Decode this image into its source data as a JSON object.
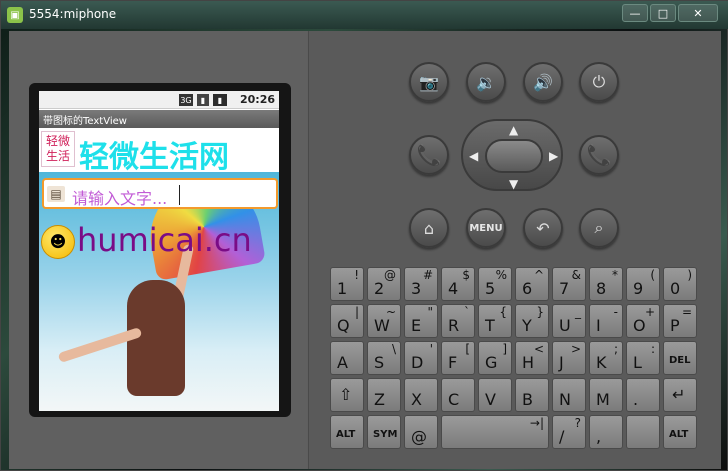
{
  "window": {
    "title": "5554:miphone",
    "controls": {
      "minimize": "—",
      "maximize": "□",
      "close": "✕"
    }
  },
  "device": {
    "status_bar": {
      "time": "20:26",
      "network": "3G"
    },
    "app_title": "带图标的TextView",
    "banner_text": "轻微生活网",
    "logo_text": "轻微生活",
    "input": {
      "placeholder": "请输入文字..."
    },
    "site_text": "humicai.cn"
  },
  "controls": {
    "top_row": [
      {
        "name": "camera-button",
        "icon": "📷"
      },
      {
        "name": "volume-down-button",
        "icon": "🔉"
      },
      {
        "name": "volume-up-button",
        "icon": "🔊"
      },
      {
        "name": "power-button",
        "icon": "⏻"
      }
    ],
    "call": {
      "call_icon": "📞",
      "end_icon": "📞"
    },
    "bottom_row": {
      "home": "⌂",
      "menu": "MENU",
      "back": "↶",
      "search": "⌕"
    }
  },
  "keyboard": {
    "rows": [
      [
        {
          "l": "1",
          "a": "!"
        },
        {
          "l": "2",
          "a": "@"
        },
        {
          "l": "3",
          "a": "#"
        },
        {
          "l": "4",
          "a": "$"
        },
        {
          "l": "5",
          "a": "%"
        },
        {
          "l": "6",
          "a": "^"
        },
        {
          "l": "7",
          "a": "&"
        },
        {
          "l": "8",
          "a": "*"
        },
        {
          "l": "9",
          "a": "("
        },
        {
          "l": "0",
          "a": ")"
        }
      ],
      [
        {
          "l": "Q",
          "a": "|"
        },
        {
          "l": "W",
          "a": "~"
        },
        {
          "l": "E",
          "a": "\""
        },
        {
          "l": "R",
          "a": "`"
        },
        {
          "l": "T",
          "a": "{"
        },
        {
          "l": "Y",
          "a": "}"
        },
        {
          "l": "U",
          "a": "_"
        },
        {
          "l": "I",
          "a": "-"
        },
        {
          "l": "O",
          "a": "+"
        },
        {
          "l": "P",
          "a": "="
        }
      ],
      [
        {
          "l": "A",
          "a": ""
        },
        {
          "l": "S",
          "a": "\\"
        },
        {
          "l": "D",
          "a": "'"
        },
        {
          "l": "F",
          "a": "["
        },
        {
          "l": "G",
          "a": "]"
        },
        {
          "l": "H",
          "a": "<"
        },
        {
          "l": "J",
          "a": ">"
        },
        {
          "l": "K",
          "a": ";"
        },
        {
          "l": "L",
          "a": ":"
        },
        {
          "l": "DEL",
          "a": ""
        }
      ],
      [
        {
          "l": "⇧",
          "a": ""
        },
        {
          "l": "Z",
          "a": ""
        },
        {
          "l": "X",
          "a": ""
        },
        {
          "l": "C",
          "a": ""
        },
        {
          "l": "V",
          "a": ""
        },
        {
          "l": "B",
          "a": ""
        },
        {
          "l": "N",
          "a": ""
        },
        {
          "l": "M",
          "a": ""
        },
        {
          "l": ".",
          "a": ""
        },
        {
          "l": "↵",
          "a": ""
        }
      ]
    ],
    "bottom": {
      "alt_left": "ALT",
      "sym": "SYM",
      "at": "@",
      "space_alt": "→|",
      "slash": "/",
      "slash_alt": "?",
      "comma": ",",
      "alt_right": "ALT"
    }
  },
  "colors": {
    "input_border": "#f39a2c",
    "banner_text": "#1ee0ea",
    "site_text": "#7a0c86",
    "call_green": "#22c34a",
    "end_red": "#ff3b3b"
  }
}
